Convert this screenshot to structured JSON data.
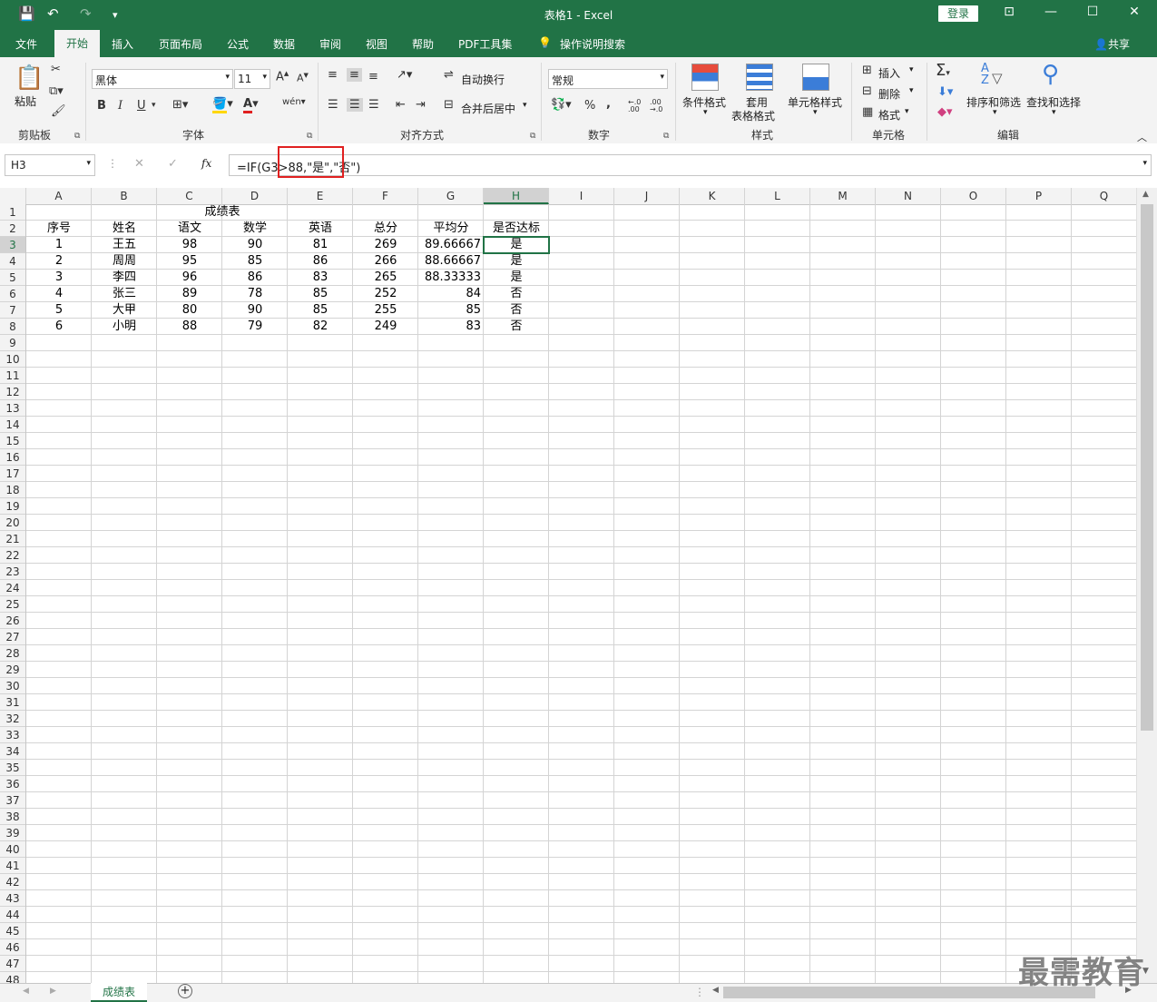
{
  "titlebar": {
    "title": "表格1  -  Excel",
    "login": "登录",
    "quick_access": {
      "save": "💾",
      "undo": "↶",
      "redo": "↷",
      "customize": "▾"
    }
  },
  "menu_tabs": [
    "文件",
    "开始",
    "插入",
    "页面布局",
    "公式",
    "数据",
    "审阅",
    "视图",
    "帮助",
    "PDF工具集",
    "操作说明搜索"
  ],
  "share": "共享",
  "ribbon": {
    "clipboard": {
      "paste": "粘贴",
      "label": "剪贴板"
    },
    "font": {
      "name": "黑体",
      "size": "11",
      "bold": "B",
      "italic": "I",
      "underline": "U",
      "label": "字体",
      "grow": "A",
      "shrink": "A",
      "wen": "wén"
    },
    "alignment": {
      "wrap": "自动换行",
      "merge": "合并后居中",
      "label": "对齐方式"
    },
    "number": {
      "format": "常规",
      "percent": "%",
      "comma": ",",
      "inc": "←.0 .00",
      "dec": ".00 →.0",
      "label": "数字"
    },
    "styles": {
      "conditional": "条件格式",
      "table1": "套用",
      "table2": "表格格式",
      "cellstyle": "单元格样式",
      "label": "样式"
    },
    "cells": {
      "insert": "插入",
      "delete": "删除",
      "format": "格式",
      "label": "单元格"
    },
    "editing": {
      "sort": "排序和筛选",
      "find": "查找和选择",
      "label": "编辑",
      "sigma": "Σ",
      "az": "A\nZ"
    }
  },
  "formula_bar": {
    "namebox": "H3",
    "cancel": "✕",
    "enter": "✓",
    "fx": "fx",
    "formula": "=IF(G3>88,\"是\",\"否\")"
  },
  "columns": [
    "A",
    "B",
    "C",
    "D",
    "E",
    "F",
    "G",
    "H",
    "I",
    "J",
    "K",
    "L",
    "M",
    "N",
    "O",
    "P",
    "Q"
  ],
  "row_count": 48,
  "sheet": {
    "title": "成绩表",
    "headers": [
      "序号",
      "姓名",
      "语文",
      "数学",
      "英语",
      "总分",
      "平均分",
      "是否达标"
    ],
    "rows": [
      [
        "1",
        "王五",
        "98",
        "90",
        "81",
        "269",
        "89.66667",
        "是"
      ],
      [
        "2",
        "周周",
        "95",
        "85",
        "86",
        "266",
        "88.66667",
        "是"
      ],
      [
        "3",
        "李四",
        "96",
        "86",
        "83",
        "265",
        "88.33333",
        "是"
      ],
      [
        "4",
        "张三",
        "89",
        "78",
        "85",
        "252",
        "84",
        "否"
      ],
      [
        "5",
        "大甲",
        "80",
        "90",
        "85",
        "255",
        "85",
        "否"
      ],
      [
        "6",
        "小明",
        "88",
        "79",
        "82",
        "249",
        "83",
        "否"
      ]
    ]
  },
  "sheet_tab": "成绩表",
  "add_sheet": "+",
  "watermark": "最需教育",
  "colors": {
    "excel_green": "#217346",
    "highlight_red": "#e02020"
  }
}
